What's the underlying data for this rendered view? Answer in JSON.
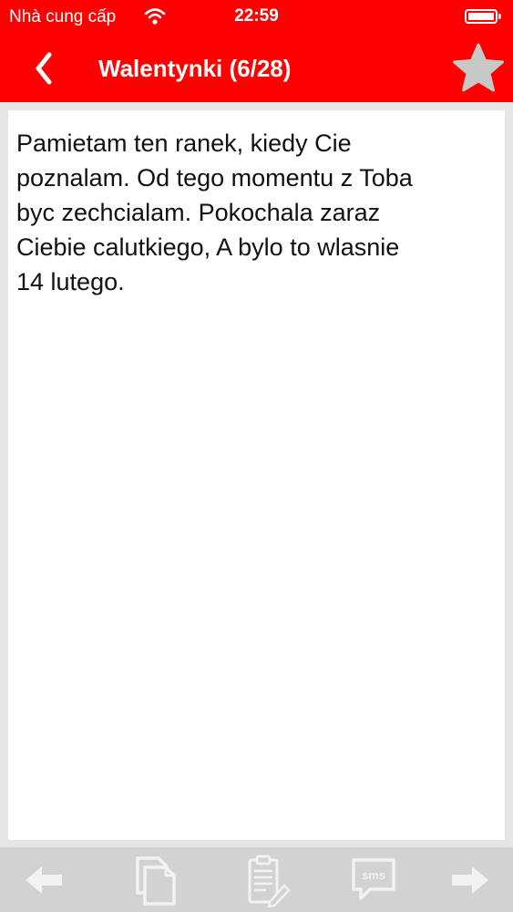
{
  "status_bar": {
    "carrier": "Nhà cung cấp",
    "time": "22:59"
  },
  "nav": {
    "title": "Walentynki (6/28)",
    "accent_color": "#ff0000"
  },
  "message": {
    "text": "Pamietam ten ranek, kiedy Cie\npoznalam. Od tego momentu z Toba\nbyc zechcialam. Pokochala zaraz\nCiebie calutkiego, A bylo to wlasnie\n14 lutego."
  },
  "toolbar": {
    "sms_label": "sms",
    "icons": [
      "arrow-left-icon",
      "copy-icon",
      "clipboard-edit-icon",
      "sms-icon",
      "arrow-right-icon"
    ]
  }
}
